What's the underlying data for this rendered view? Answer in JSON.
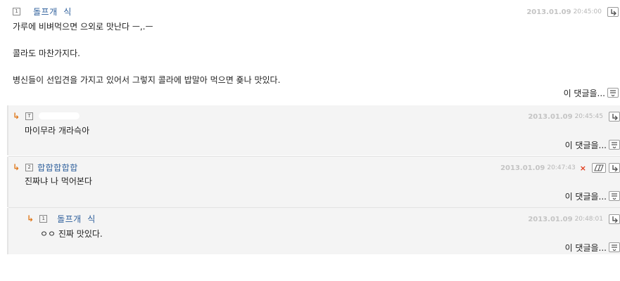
{
  "comments": [
    {
      "level": "1",
      "nickname": "돌프개  식",
      "date": "2013.01.09",
      "time": "20:45:00",
      "lines": [
        "가루에 비벼먹으면 으외로 맛난다 ㅡ,.ㅡ",
        "",
        "콜라도 마찬가지다.",
        "",
        "병신들이 선입견을 가지고 있어서 그렇지 콜라에 밥말아 먹으면 죶나 맛있다."
      ],
      "more_label": "이 댓글을..."
    },
    {
      "level": "T",
      "nickname": "",
      "date": "2013.01.09",
      "time": "20:45:45",
      "lines": [
        "마이무라 개라슥아"
      ],
      "more_label": "이 댓글을..."
    },
    {
      "level": "2",
      "nickname": "합합합합합",
      "date": "2013.01.09",
      "time": "20:47:43",
      "delete_mark": "×",
      "lines": [
        "진짜냐 나 먹어본다"
      ],
      "more_label": "이 댓글을..."
    },
    {
      "level": "1",
      "nickname": "돌프개  식",
      "date": "2013.01.09",
      "time": "20:48:01",
      "lines": [
        "ㅇㅇ 진짜 맛있다."
      ],
      "more_label": "이 댓글을..."
    }
  ],
  "reply_arrow": "↳",
  "icons": {
    "reply": "reply-icon",
    "more": "list-menu-icon",
    "edit": "eraser-edit-icon",
    "delete": "delete-x-icon"
  },
  "colors": {
    "nickname": "#2b5d9a",
    "reply_arrow": "#e07a1e",
    "delete": "#e03a1a",
    "reply_bg": "#f4f4f4"
  }
}
